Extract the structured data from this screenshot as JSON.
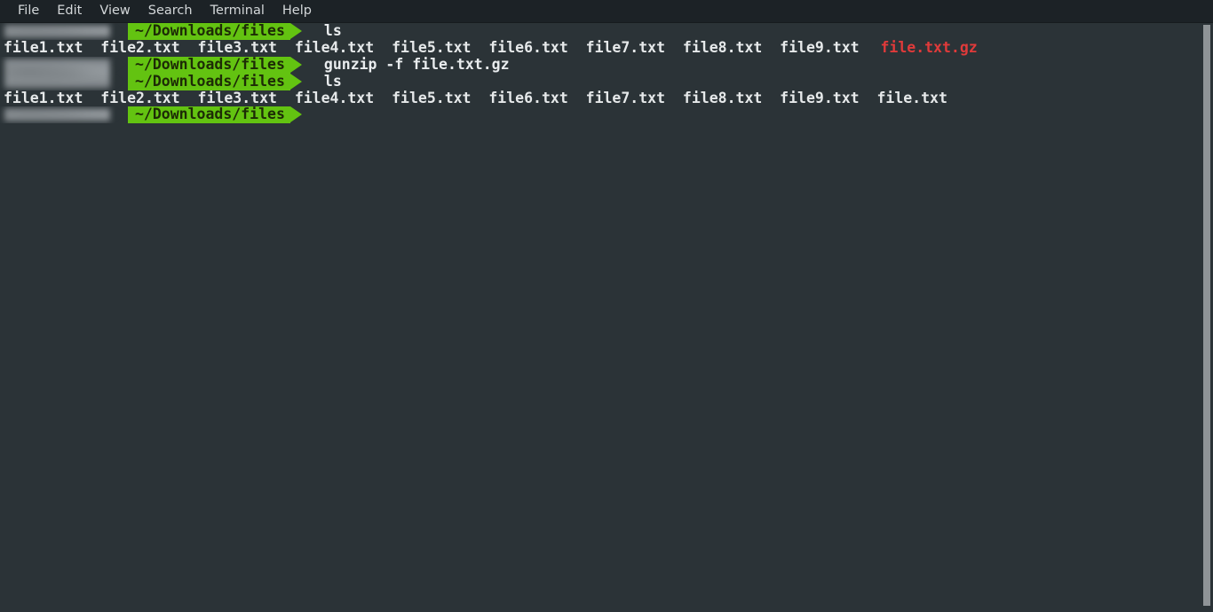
{
  "window": {
    "app": "Terminal",
    "background_color": "#2b3337",
    "menubar_color": "#1c2226"
  },
  "menubar": {
    "items": [
      {
        "label": "File",
        "name": "menu-file"
      },
      {
        "label": "Edit",
        "name": "menu-edit"
      },
      {
        "label": "View",
        "name": "menu-view"
      },
      {
        "label": "Search",
        "name": "menu-search"
      },
      {
        "label": "Terminal",
        "name": "menu-terminal"
      },
      {
        "label": "Help",
        "name": "menu-help"
      }
    ]
  },
  "colors": {
    "prompt_green": "#63c311",
    "prompt_text_dark": "#1d2b06",
    "archive_red": "#e03a3a",
    "foreground": "#e6e9ea",
    "redacted_gray": "#8d9296"
  },
  "terminal": {
    "prompt_path": "~/Downloads/files",
    "redacted_label": "",
    "lines": [
      {
        "type": "prompt",
        "path": "~/Downloads/files",
        "command": "ls"
      },
      {
        "type": "output",
        "text": "file1.txt  file2.txt  file3.txt  file4.txt  file5.txt  file6.txt  file7.txt  file8.txt  file9.txt  ",
        "highlight": "file.txt.gz",
        "highlight_color": "#e03a3a"
      },
      {
        "type": "prompt",
        "path": "~/Downloads/files",
        "command": "gunzip -f file.txt.gz"
      },
      {
        "type": "prompt",
        "path": "~/Downloads/files",
        "command": "ls"
      },
      {
        "type": "output",
        "text": "file1.txt  file2.txt  file3.txt  file4.txt  file5.txt  file6.txt  file7.txt  file8.txt  file9.txt  file.txt",
        "highlight": "",
        "highlight_color": ""
      },
      {
        "type": "prompt",
        "path": "~/Downloads/files",
        "command": ""
      }
    ]
  },
  "scrollbar": {
    "present": true,
    "position": "right"
  }
}
